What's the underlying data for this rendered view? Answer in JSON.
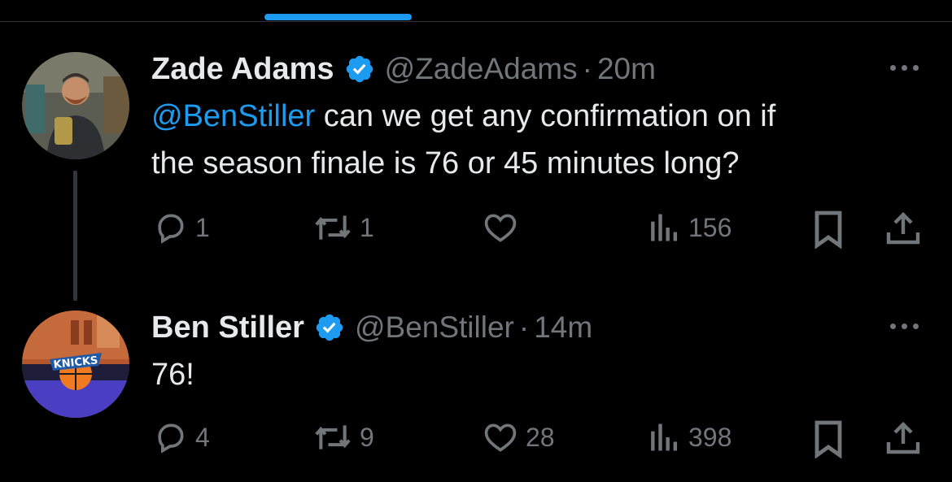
{
  "tweets": [
    {
      "name": "Zade Adams",
      "handle": "@ZadeAdams",
      "separator": "·",
      "time": "20m",
      "text_mention": "@BenStiller",
      "text_line1_rest": " can we get any confirmation on if",
      "text_line2": "the season finale is 76 or 45 minutes long?",
      "replies": "1",
      "retweets": "1",
      "likes": "",
      "views": "156"
    },
    {
      "name": "Ben Stiller",
      "handle": "@BenStiller",
      "separator": "·",
      "time": "14m",
      "text": "76!",
      "avatar_text": "KNICKS",
      "replies": "4",
      "retweets": "9",
      "likes": "28",
      "views": "398"
    }
  ],
  "colors": {
    "background": "#000000",
    "accent": "#1d9bf0",
    "secondary_text": "#71767b",
    "primary_text": "#e7e9ea"
  },
  "icons": [
    "verified-badge-icon",
    "reply-icon",
    "retweet-icon",
    "like-icon",
    "views-icon",
    "bookmark-icon",
    "share-icon",
    "more-icon"
  ]
}
